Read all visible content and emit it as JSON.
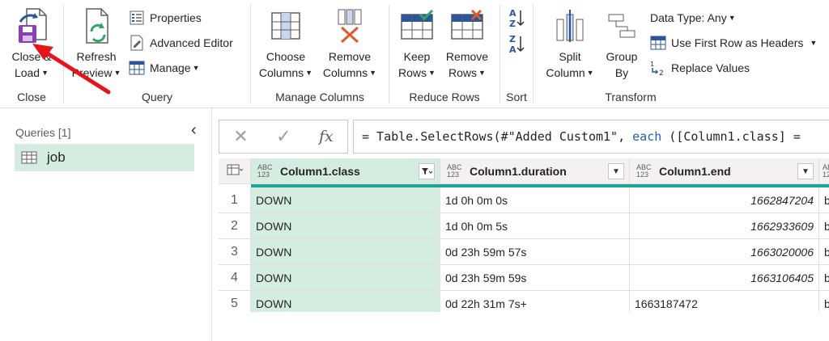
{
  "ribbon": {
    "close_group": {
      "label": "Close",
      "close_load": {
        "line1": "Close &",
        "line2": "Load"
      }
    },
    "query_group": {
      "label": "Query",
      "refresh_preview": {
        "line1": "Refresh",
        "line2": "Preview"
      },
      "properties": "Properties",
      "advanced_editor": "Advanced Editor",
      "manage": "Manage"
    },
    "manage_columns_group": {
      "label": "Manage Columns",
      "choose_columns": {
        "line1": "Choose",
        "line2": "Columns"
      },
      "remove_columns": {
        "line1": "Remove",
        "line2": "Columns"
      }
    },
    "reduce_rows_group": {
      "label": "Reduce Rows",
      "keep_rows": {
        "line1": "Keep",
        "line2": "Rows"
      },
      "remove_rows": {
        "line1": "Remove",
        "line2": "Rows"
      }
    },
    "sort_group": {
      "label": "Sort"
    },
    "transform_group": {
      "label": "Transform",
      "split_column": {
        "line1": "Split",
        "line2": "Column"
      },
      "group_by": {
        "line1": "Group",
        "line2": "By"
      },
      "data_type": "Data Type: Any",
      "use_first_row": "Use First Row as Headers",
      "replace_values": "Replace Values"
    }
  },
  "queries_pane": {
    "title": "Queries [1]",
    "items": [
      {
        "name": "job"
      }
    ]
  },
  "formula_bar": {
    "fx": "fx",
    "prefix": "= Table.SelectRows(#\"Added Custom1\", ",
    "keyword": "each",
    "suffix": " ([Column1.class] ="
  },
  "table": {
    "type_badge": {
      "top": "ABC",
      "bottom": "123"
    },
    "columns": [
      {
        "name": "Column1.class"
      },
      {
        "name": "Column1.duration"
      },
      {
        "name": "Column1.end"
      }
    ],
    "rows": [
      {
        "n": "1",
        "class": "DOWN",
        "duration": "1d 0h 0m 0s",
        "end": "1662847204",
        "extra": "b"
      },
      {
        "n": "2",
        "class": "DOWN",
        "duration": "1d 0h 0m 5s",
        "end": "1662933609",
        "extra": "b"
      },
      {
        "n": "3",
        "class": "DOWN",
        "duration": "0d 23h 59m 57s",
        "end": "1663020006",
        "extra": "b"
      },
      {
        "n": "4",
        "class": "DOWN",
        "duration": "0d 23h 59m 59s",
        "end": "1663106405",
        "extra": "b"
      },
      {
        "n": "5",
        "class": "DOWN",
        "duration": "0d 22h 31m 7s+",
        "end": "1663187472",
        "extra": "b"
      }
    ]
  },
  "colors": {
    "accent_green": "#d5ece0",
    "teal": "#1fa596",
    "arrow_red": "#e8141c",
    "keyword_blue": "#1f5fbf"
  }
}
